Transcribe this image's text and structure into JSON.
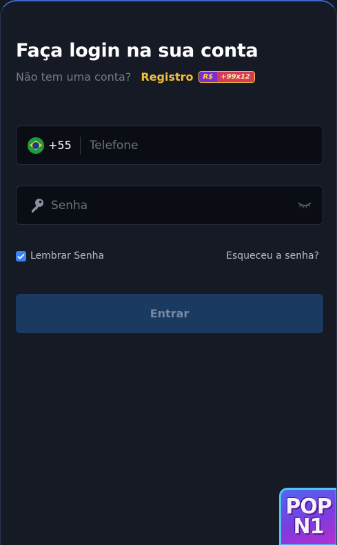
{
  "login": {
    "title": "Faça login na sua conta",
    "no_account_text": "Não tem uma conta?",
    "register_label": "Registro",
    "bonus_currency": "R$",
    "bonus_amount": "+99x12"
  },
  "phone_field": {
    "country_code": "+55",
    "placeholder": "Telefone",
    "value": ""
  },
  "password_field": {
    "placeholder": "Senha",
    "value": ""
  },
  "remember": {
    "label": "Lembrar Senha",
    "checked": true
  },
  "forgot_label": "Esqueceu a senha?",
  "submit_label": "Entrar",
  "app_logo": {
    "line1": "POP",
    "line2": "N1"
  },
  "icons": {
    "flag": "brazil-flag-icon",
    "key": "key-icon",
    "eye": "eye-closed-icon",
    "check": "check-icon"
  },
  "colors": {
    "background": "#151a24",
    "accent_gold": "#f3bd3c",
    "button_bg": "#1a3a62",
    "checkbox": "#3b82f6"
  }
}
